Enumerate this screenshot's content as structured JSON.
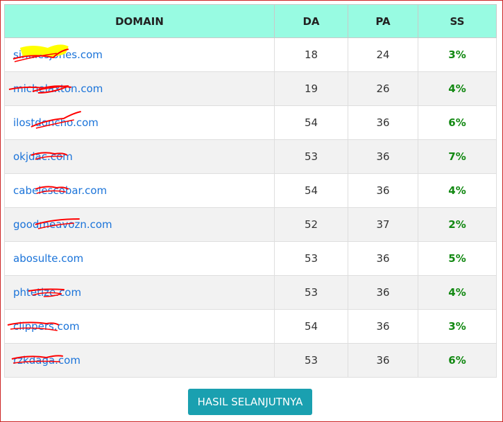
{
  "table": {
    "headers": {
      "domain": "DOMAIN",
      "da": "DA",
      "pa": "PA",
      "ss": "SS"
    },
    "rows": [
      {
        "domain": "sindiesjones.com",
        "da": "18",
        "pa": "24",
        "ss": "3%"
      },
      {
        "domain": "michelaxton.com",
        "da": "19",
        "pa": "26",
        "ss": "4%"
      },
      {
        "domain": "ilostdoncho.com",
        "da": "54",
        "pa": "36",
        "ss": "6%"
      },
      {
        "domain": "okjdac.com",
        "da": "53",
        "pa": "36",
        "ss": "7%"
      },
      {
        "domain": "cabelescobar.com",
        "da": "54",
        "pa": "36",
        "ss": "4%"
      },
      {
        "domain": "goodmeavozn.com",
        "da": "52",
        "pa": "37",
        "ss": "2%"
      },
      {
        "domain": "abosulte.com",
        "da": "53",
        "pa": "36",
        "ss": "5%"
      },
      {
        "domain": "phtetize.com",
        "da": "53",
        "pa": "36",
        "ss": "4%"
      },
      {
        "domain": "clippers.com",
        "da": "54",
        "pa": "36",
        "ss": "3%"
      },
      {
        "domain": "rzkdaga.com",
        "da": "53",
        "pa": "36",
        "ss": "6%"
      }
    ]
  },
  "button": {
    "next_label": "HASIL SELANJUTNYA"
  },
  "colors": {
    "header_bg": "#98fbe2",
    "link": "#1a73d9",
    "ss_text": "#118811",
    "button_bg": "#1aa0b0",
    "redaction": "#ff0000",
    "highlight": "#ffff00"
  }
}
